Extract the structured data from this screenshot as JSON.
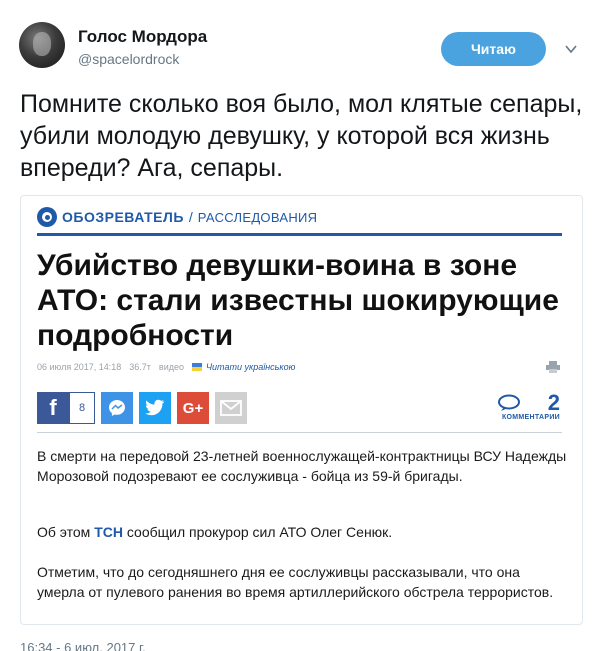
{
  "user": {
    "name": "Голос Мордора",
    "handle": "@spacelordrock"
  },
  "follow_button": {
    "label": "Читаю",
    "color": "#4aa3de"
  },
  "tweet_text": "Помните сколько воя было, мол клятые сепары, убили молодую девушку, у которой вся жизнь впереди? Ага, сепары.",
  "embed": {
    "logo": "ОБОЗРЕВАТЕЛЬ",
    "separator": "/",
    "section": "РАССЛЕДОВАНИЯ",
    "brand_color": "#1f5aa8",
    "headline": "Убийство девушки-воина в зоне АТО: стали известны шокирующие подробности",
    "meta": {
      "date": "06 июля 2017, 14:18",
      "views": "36.7т",
      "video": "видео",
      "link": "Читати українською"
    },
    "share": {
      "facebook_count": "8",
      "icons": [
        "facebook-icon",
        "messenger-icon",
        "twitter-icon",
        "google-plus-icon",
        "mail-icon"
      ]
    },
    "comments": {
      "count": "2",
      "label": "КОММЕНТАРИИ"
    },
    "paragraphs": {
      "p1": "В смерти на передовой 23-летней военнослужащей-контрактницы ВСУ Надежды Морозовой подозревают ее сослуживца - бойца из 59-й бригады.",
      "p2_before": "Об этом ",
      "p2_link": "ТСН",
      "p2_after": " сообщил прокурор сил АТО Олег Сенюк.",
      "p3": "Отметим, что до сегодняшнего дня ее сослуживцы рассказывали, что она умерла от пулевого ранения во время артиллерийского обстрела террористов."
    }
  },
  "timestamp": "16:34 - 6 июл. 2017 г."
}
